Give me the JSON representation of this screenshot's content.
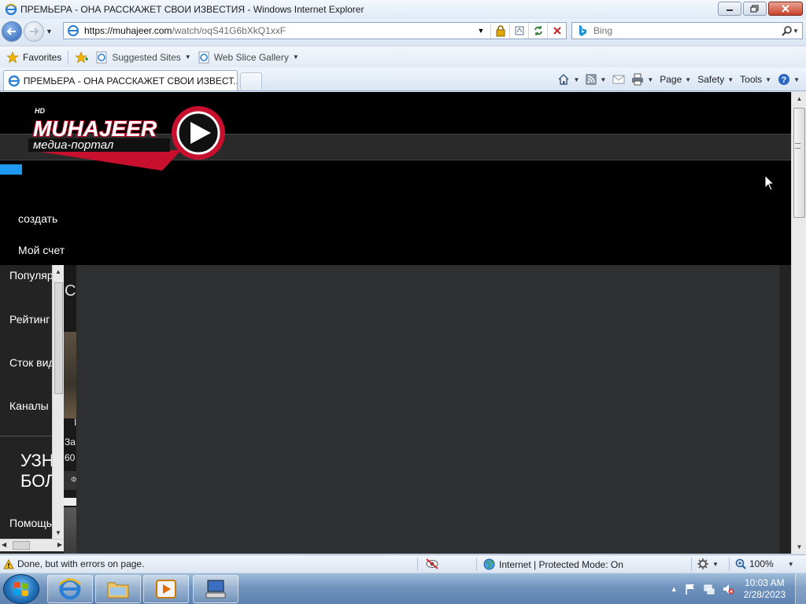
{
  "window": {
    "title": "ПРЕМЬЕРА - ОНА РАССКАЖЕТ СВОИ ИЗВЕСТИЯ - Windows Internet Explorer"
  },
  "address": {
    "url_host": "https://muhajeer.com",
    "url_path": "/watch/oqS41G6bXkQ1xxF"
  },
  "search": {
    "placeholder": "Bing"
  },
  "favorites_bar": {
    "favorites": "Favorites",
    "suggested": "Suggested Sites",
    "webslice": "Web Slice Gallery"
  },
  "tab": {
    "title": "ПРЕМЬЕРА - ОНА РАССКАЖЕТ СВОИ ИЗВЕСТ..."
  },
  "commands": {
    "page": "Page",
    "safety": "Safety",
    "tools": "Tools"
  },
  "site": {
    "logo_hd": "HD",
    "logo_name": "MUHAJEER",
    "logo_sub": "медиа-портал",
    "menu_create": "создать",
    "menu_account": "Мой счет",
    "nav": [
      "Популяр",
      "Рейтинг",
      "Сток вид",
      "Каналы"
    ],
    "big_text_line1": "УЗН",
    "big_text_line2": "БОЛ",
    "help_link": "Помощь",
    "mid_c": "С.",
    "mid_i": "I",
    "mid_za": "За",
    "mid_60": "60",
    "mid_f": "Ф"
  },
  "statusbar": {
    "message": "Done, but with errors on page.",
    "zone": "Internet | Protected Mode: On",
    "zoom": "100%"
  },
  "taskbar": {
    "time": "10:03 AM",
    "date": "2/28/2023"
  },
  "colors": {
    "accent_blue": "#1e9bf0",
    "logo_red": "#c8102e"
  }
}
